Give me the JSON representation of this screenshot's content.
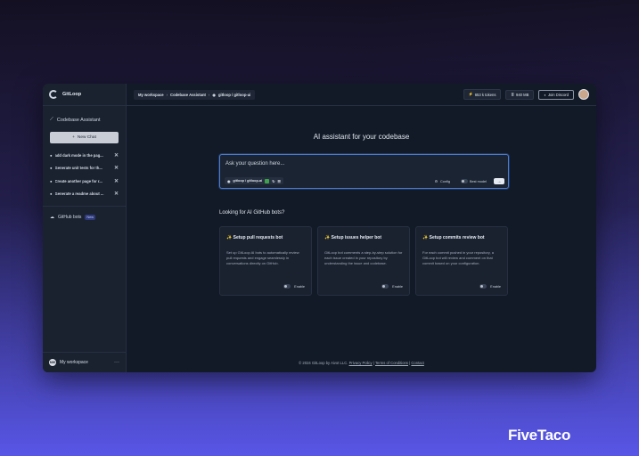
{
  "brand": "FiveTaco",
  "app": {
    "name": "GitLoop"
  },
  "sidebar": {
    "section_title": "Codebase Assistant",
    "new_chat_label": "New Chat",
    "chats": [
      "add dark mode in the pag...",
      "Generate unit tests for th...",
      "Create another page for r...",
      "Generate a readme about ..."
    ],
    "github_bots_label": "GitHub bots",
    "new_badge": "New",
    "workspace": {
      "initials": "MW",
      "label": "My workspace"
    }
  },
  "topbar": {
    "breadcrumb": [
      "My workspace",
      "Codebase Assistant",
      "gitloop / gitloop-ai"
    ],
    "tokens": "653 k tokens",
    "storage": "940 MB",
    "discord": "Join Discord"
  },
  "hero": {
    "title": "AI assistant for your codebase",
    "placeholder": "Ask your question here...",
    "repo": "gitloop / gitloop-ai",
    "config_label": "Config",
    "best_model_label": "Best model"
  },
  "bots": {
    "heading": "Looking for AI GitHub bots?",
    "cards": [
      {
        "title": "✨ Setup pull requests bot",
        "desc": "Set up GitLoop AI bots to automatically review pull requests and engage seamlessly in conversations directly on GitHub.",
        "enable": "Enable"
      },
      {
        "title": "✨ Setup issues helper bot",
        "desc": "GitLoop bot comments a step-by-step solution for each issue created in your repository by understanding the issue and codebase.",
        "enable": "Enable"
      },
      {
        "title": "✨ Setup commits review bot",
        "desc": "For each commit pushed in your repository, a GitLoop bot will review and comment on that commit based on your configuration.",
        "enable": "Enable"
      }
    ]
  },
  "footer": {
    "copyright": "© 2024 GitLoop by Aivot LLC.",
    "privacy": "Privacy Policy",
    "terms": "Terms of Conditions",
    "contact": "Contact"
  }
}
